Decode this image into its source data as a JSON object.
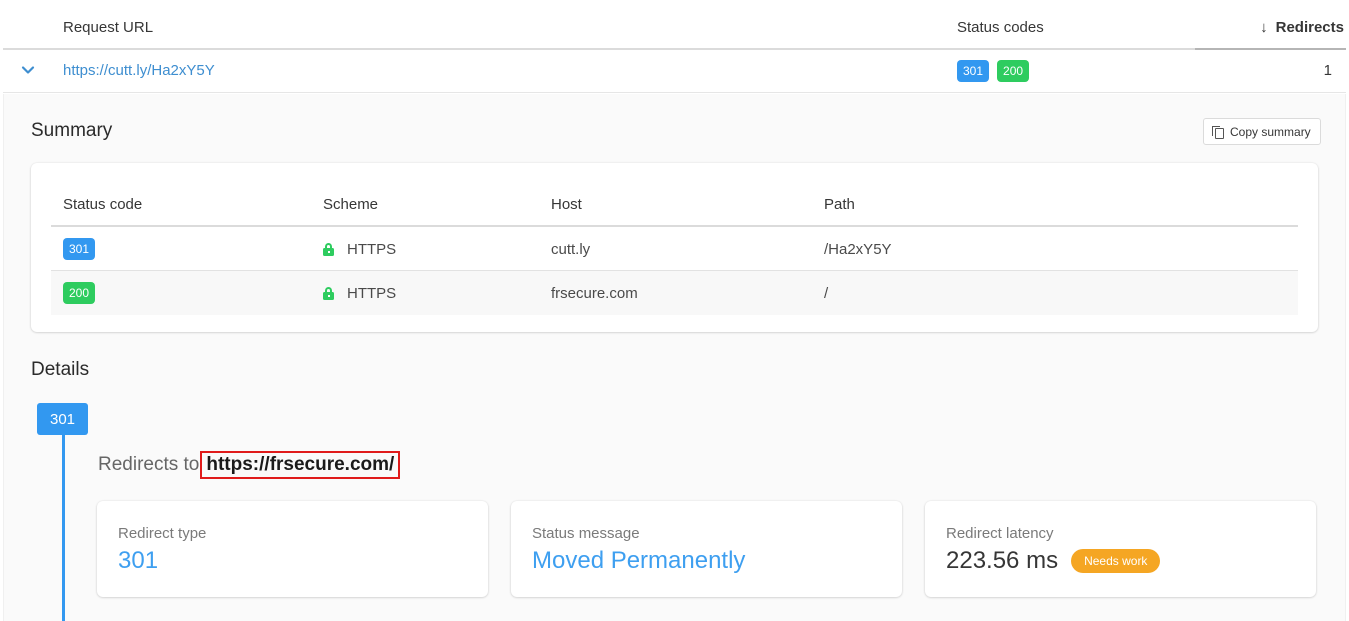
{
  "table": {
    "columns": {
      "request_url": "Request URL",
      "status_codes": "Status codes",
      "redirects": "Redirects",
      "sort_icon": "arrow-down-icon"
    },
    "row": {
      "url": "https://cutt.ly/Ha2xY5Y",
      "status_codes": [
        "301",
        "200"
      ],
      "redirects": "1",
      "expanded": true
    }
  },
  "summary": {
    "title": "Summary",
    "copy_button": "Copy summary",
    "columns": [
      "Status code",
      "Scheme",
      "Host",
      "Path"
    ],
    "rows": [
      {
        "status": "301",
        "scheme": "HTTPS",
        "host": "cutt.ly",
        "path": "/Ha2xY5Y"
      },
      {
        "status": "200",
        "scheme": "HTTPS",
        "host": "frsecure.com",
        "path": "/"
      }
    ]
  },
  "details": {
    "title": "Details",
    "step": {
      "status": "301",
      "redirects_to_label": "Redirects to",
      "redirects_to_url": "https://frsecure.com/",
      "metrics": [
        {
          "label": "Redirect type",
          "value": "301"
        },
        {
          "label": "Status message",
          "value": "Moved Permanently"
        },
        {
          "label": "Redirect latency",
          "value": "223.56 ms",
          "badge": "Needs work"
        }
      ]
    }
  },
  "colors": {
    "link": "#3e8ed0",
    "status_301": "#3298f0",
    "status_200": "#2ecc5f",
    "warning": "#f5a623",
    "highlight_border": "#e01b1b"
  }
}
